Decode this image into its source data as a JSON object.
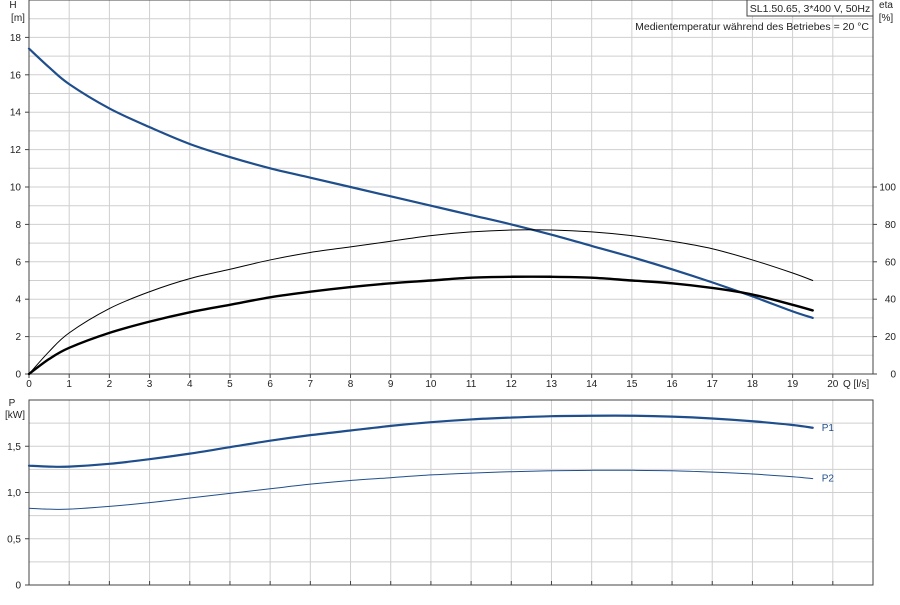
{
  "chart_data": [
    {
      "type": "line",
      "panel": "upper",
      "title": "SL1.50.65, 3*400 V, 50Hz",
      "note": "Medientemperatur während des Betriebes = 20 °C",
      "xlabel": "Q [l/s]",
      "ylabel_left": [
        "H",
        "[m]"
      ],
      "ylabel_right": [
        "eta",
        "[%]"
      ],
      "xlim": [
        0,
        21
      ],
      "ylim": [
        0,
        20
      ],
      "ylim_right": [
        0,
        200
      ],
      "x_ticks": [
        0,
        1,
        2,
        3,
        4,
        5,
        6,
        7,
        8,
        9,
        10,
        11,
        12,
        13,
        14,
        15,
        16,
        17,
        18,
        19,
        20
      ],
      "y_ticks": [
        0,
        2,
        4,
        6,
        8,
        10,
        12,
        14,
        16,
        18
      ],
      "y_ticks_right": [
        0,
        20,
        40,
        60,
        80,
        100
      ],
      "grid": true,
      "series": [
        {
          "axis": "left",
          "color": "#1f4e8c",
          "stroke_width": 2.2,
          "x": [
            0,
            0.5,
            1,
            2,
            3,
            4,
            5,
            6,
            7,
            8,
            9,
            10,
            11,
            12,
            13,
            14,
            15,
            16,
            17,
            18,
            19,
            19.5
          ],
          "y": [
            17.4,
            16.4,
            15.5,
            14.2,
            13.2,
            12.3,
            11.6,
            11.0,
            10.5,
            10.0,
            9.5,
            9.0,
            8.5,
            8.0,
            7.45,
            6.85,
            6.25,
            5.6,
            4.9,
            4.15,
            3.35,
            3.0
          ]
        },
        {
          "axis": "right",
          "color": "#000000",
          "stroke_width": 1,
          "x": [
            0,
            0.5,
            1,
            2,
            3,
            4,
            5,
            6,
            7,
            8,
            9,
            10,
            11,
            12,
            13,
            14,
            15,
            16,
            17,
            18,
            19,
            19.5
          ],
          "y": [
            0,
            12,
            22,
            35,
            44,
            51,
            56,
            61,
            65,
            68,
            71,
            74,
            76,
            77,
            77,
            76,
            74,
            71,
            67,
            61,
            54,
            50
          ]
        },
        {
          "axis": "right",
          "color": "#000000",
          "stroke_width": 2.4,
          "x": [
            0,
            0.5,
            1,
            2,
            3,
            4,
            5,
            6,
            7,
            8,
            9,
            10,
            11,
            12,
            13,
            14,
            15,
            16,
            17,
            18,
            19,
            19.5
          ],
          "y": [
            0,
            8,
            14,
            22,
            28,
            33,
            37,
            41,
            44,
            46.5,
            48.5,
            50,
            51.5,
            52,
            52,
            51.5,
            50,
            48.5,
            46,
            42.5,
            37,
            34
          ]
        }
      ]
    },
    {
      "type": "line",
      "panel": "lower",
      "ylabel": [
        "P",
        "[kW]"
      ],
      "xlim": [
        0,
        21
      ],
      "ylim": [
        0,
        2
      ],
      "y_ticks": [
        0,
        0.5,
        1.0,
        1.5
      ],
      "y_tick_labels": [
        "0",
        "0,5",
        "1,0",
        "1,5"
      ],
      "grid": true,
      "series": [
        {
          "name": "P1",
          "color": "#1f4e8c",
          "stroke_width": 2.2,
          "x": [
            0,
            0.5,
            1,
            2,
            3,
            4,
            5,
            6,
            7,
            8,
            9,
            10,
            11,
            12,
            13,
            14,
            15,
            16,
            17,
            18,
            19,
            19.5
          ],
          "y": [
            1.29,
            1.28,
            1.28,
            1.31,
            1.36,
            1.42,
            1.49,
            1.56,
            1.62,
            1.67,
            1.72,
            1.76,
            1.79,
            1.81,
            1.825,
            1.83,
            1.83,
            1.82,
            1.8,
            1.77,
            1.73,
            1.7
          ]
        },
        {
          "name": "P2",
          "color": "#1f4e8c",
          "stroke_width": 1,
          "x": [
            0,
            0.5,
            1,
            2,
            3,
            4,
            5,
            6,
            7,
            8,
            9,
            10,
            11,
            12,
            13,
            14,
            15,
            16,
            17,
            18,
            19,
            19.5
          ],
          "y": [
            0.83,
            0.82,
            0.82,
            0.85,
            0.89,
            0.94,
            0.99,
            1.04,
            1.09,
            1.13,
            1.16,
            1.19,
            1.21,
            1.225,
            1.235,
            1.24,
            1.24,
            1.235,
            1.22,
            1.2,
            1.17,
            1.15
          ]
        }
      ]
    }
  ]
}
